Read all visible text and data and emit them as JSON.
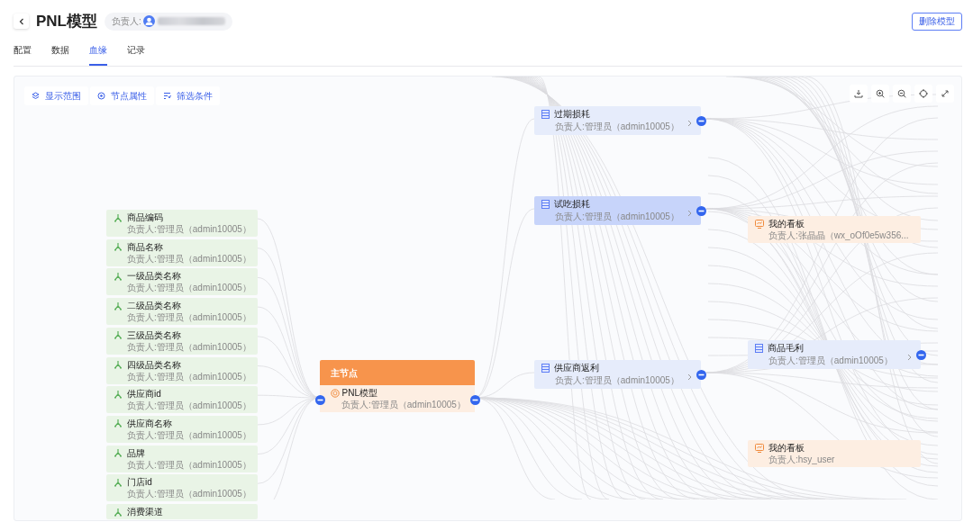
{
  "header": {
    "title": "PNL模型",
    "owner_label": "负责人:",
    "delete_button": "删除模型"
  },
  "tabs": [
    {
      "label": "配置",
      "selected": false
    },
    {
      "label": "数据",
      "selected": false
    },
    {
      "label": "血缘",
      "selected": true
    },
    {
      "label": "记录",
      "selected": false
    }
  ],
  "toolbar": [
    "显示范围",
    "节点属性",
    "筛选条件"
  ],
  "source_fields": [
    {
      "name": "商品编码",
      "owner": "负责人:管理员（admin10005）"
    },
    {
      "name": "商品名称",
      "owner": "负责人:管理员（admin10005）"
    },
    {
      "name": "一级品类名称",
      "owner": "负责人:管理员（admin10005）"
    },
    {
      "name": "二级品类名称",
      "owner": "负责人:管理员（admin10005）"
    },
    {
      "name": "三级品类名称",
      "owner": "负责人:管理员（admin10005）"
    },
    {
      "name": "四级品类名称",
      "owner": "负责人:管理员（admin10005）"
    },
    {
      "name": "供应商id",
      "owner": "负责人:管理员（admin10005）"
    },
    {
      "name": "供应商名称",
      "owner": "负责人:管理员（admin10005）"
    },
    {
      "name": "品牌",
      "owner": "负责人:管理员（admin10005）"
    },
    {
      "name": "门店id",
      "owner": "负责人:管理员（admin10005）"
    },
    {
      "name": "消费渠道"
    }
  ],
  "main_node": {
    "header": "主节点",
    "name": "PNL模型",
    "owner": "负责人:管理员（admin10005）"
  },
  "middle_nodes": [
    {
      "kind": "table",
      "name": "过期损耗",
      "owner": "负责人:管理员（admin10005）",
      "selected": false
    },
    {
      "kind": "table",
      "name": "试吃损耗",
      "owner": "负责人:管理员（admin10005）",
      "selected": true
    },
    {
      "kind": "table",
      "name": "供应商返利",
      "owner": "负责人:管理员（admin10005）",
      "selected": false
    }
  ],
  "right_nodes": [
    {
      "kind": "dashboard",
      "name": "我的看板",
      "owner": "负责人:张晶晶（wx_oOf0e5w356..."
    },
    {
      "kind": "table",
      "name": "商品毛利",
      "owner": "负责人:管理员（admin10005）"
    },
    {
      "kind": "dashboard",
      "name": "我的看板",
      "owner": "负责人:hsy_user"
    }
  ]
}
